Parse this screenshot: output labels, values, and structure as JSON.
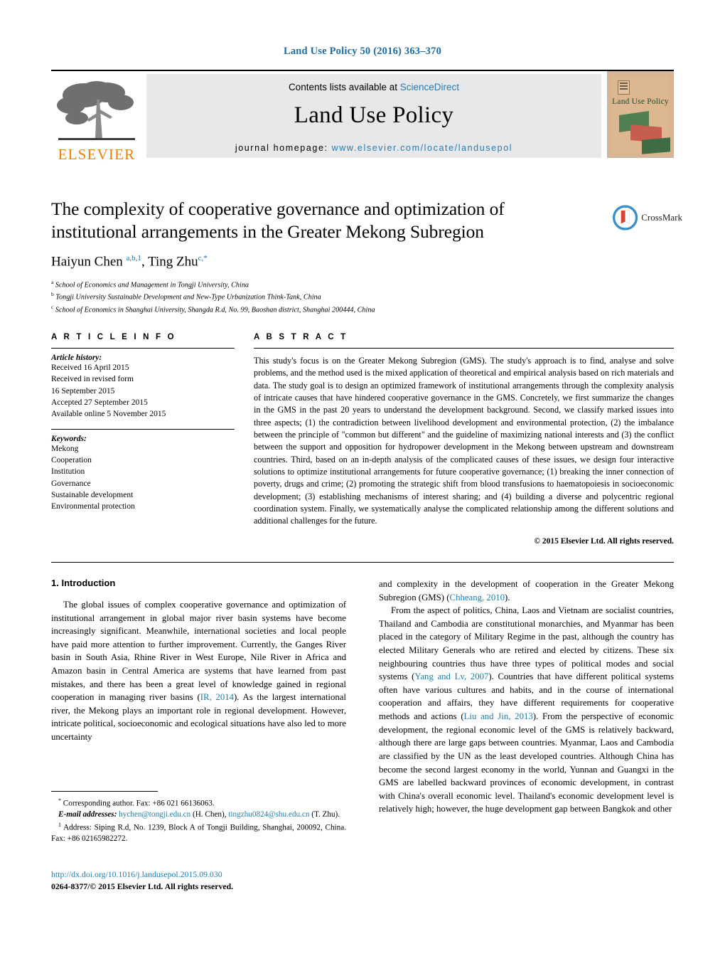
{
  "running_head": "Land Use Policy 50 (2016) 363–370",
  "masthead": {
    "contents_prefix": "Contents lists available at ",
    "sciencedirect": "ScienceDirect",
    "journal_name": "Land Use Policy",
    "homepage_label": "journal homepage:",
    "homepage_url": "www.elsevier.com/locate/landusepol",
    "publisher_name": "ELSEVIER",
    "cover_title": "Land Use Policy"
  },
  "article": {
    "title": "The complexity of cooperative governance and optimization of institutional arrangements in the Greater Mekong Subregion",
    "authors_html": "Haiyun Chen <sup>a,b,1</sup>, Ting Zhu<sup>c,*</sup>",
    "affiliations": [
      {
        "marker": "a",
        "text": "School of Economics and Management in Tongji University, China"
      },
      {
        "marker": "b",
        "text": "Tongji University Sustainable Development and New-Type Urbanization Think-Tank, China"
      },
      {
        "marker": "c",
        "text": "School of Economics in Shanghai University, Shangda R.d, No. 99, Baoshan district, Shanghai 200444, China"
      }
    ]
  },
  "crossmark": {
    "label": "CrossMark"
  },
  "article_info": {
    "heading": "A R T I C L E   I N F O",
    "history_heading": "Article history:",
    "history": [
      "Received 16 April 2015",
      "Received in revised form",
      "16 September 2015",
      "Accepted 27 September 2015",
      "Available online 5 November 2015"
    ],
    "keywords_heading": "Keywords:",
    "keywords": [
      "Mekong",
      "Cooperation",
      "Institution",
      "Governance",
      "Sustainable development",
      "Environmental protection"
    ]
  },
  "abstract": {
    "heading": "A B S T R A C T",
    "text": "This study's focus is on the Greater Mekong Subregion (GMS). The study's approach is to find, analyse and solve problems, and the method used is the mixed application of theoretical and empirical analysis based on rich materials and data. The study goal is to design an optimized framework of institutional arrangements through the complexity analysis of intricate causes that have hindered cooperative governance in the GMS. Concretely, we first summarize the changes in the GMS in the past 20 years to understand the development background. Second, we classify marked issues into three aspects; (1) the contradiction between livelihood development and environmental protection, (2) the imbalance between the principle of \"common but different\" and the guideline of maximizing national interests and (3) the conflict between the support and opposition for hydropower development in the Mekong between upstream and downstream countries. Third, based on an in-depth analysis of the complicated causes of these issues, we design four interactive solutions to optimize institutional arrangements for future cooperative governance; (1) breaking the inner connection of poverty, drugs and crime; (2) promoting the strategic shift from blood transfusions to haematopoiesis in socioeconomic development; (3) establishing mechanisms of interest sharing; and (4) building a diverse and polycentric regional coordination system. Finally, we systematically analyse the complicated relationship among the different solutions and additional challenges for the future.",
    "copyright": "© 2015 Elsevier Ltd. All rights reserved."
  },
  "body": {
    "section_number_title": "1.  Introduction",
    "left_paragraph_html": "The global issues of complex cooperative governance and optimization of institutional arrangement in global major river basin systems have become increasingly significant. Meanwhile, international societies and local people have paid more attention to further improvement. Currently, the Ganges River basin in South Asia, Rhine River in West Europe, Nile River in Africa and Amazon basin in Central America are systems that have learned from past mistakes, and there has been a great level of knowledge gained in regional cooperation in managing river basins (<span class=\"cite\">IR, 2014</span>). As the largest international river, the Mekong plays an important role in regional development. However, intricate political, socioeconomic and ecological situations have also led to more uncertainty",
    "right_paragraph_1_html": "and complexity in the development of cooperation in the Greater Mekong Subregion (GMS) (<span class=\"cite\">Chheang, 2010</span>).",
    "right_paragraph_2_html": "From the aspect of politics, China, Laos and Vietnam are socialist countries, Thailand and Cambodia are constitutional monarchies, and Myanmar has been placed in the category of Military Regime in the past, although the country has elected Military Generals who are retired and elected by citizens. These six neighbouring countries thus have three types of political modes and social systems (<span class=\"cite\">Yang and Lv, 2007</span>). Countries that have different political systems often have various cultures and habits, and in the course of international cooperation and affairs, they have different requirements for cooperative methods and actions (<span class=\"cite\">Liu and Jin, 2013</span>). From the perspective of economic development, the regional economic level of the GMS is relatively backward, although there are large gaps between countries. Myanmar, Laos and Cambodia are classified by the UN as the least developed countries. Although China has become the second largest economy in the world, Yunnan and Guangxi in the GMS are labelled backward provinces of economic development, in contrast with China's overall economic level. Thailand's economic development level is relatively high; however, the huge development gap between Bangkok and other"
  },
  "footnotes": {
    "corresponding_html": "<sup>*</sup>  Corresponding author. Fax: +86 021 66136063.",
    "email_html": "<em>E-mail addresses:</em> <span class=\"mail\">hychen@tongji.edu.cn</span> (H. Chen), <span class=\"mail\">tingzhu0824@shu.edu.cn</span> (T. Zhu).",
    "address_html": "<sup>1</sup>  Address: Siping R.d, No. 1239, Block A of Tongji Building, Shanghai, 200092, China. Fax: +86 02165982272."
  },
  "footer": {
    "doi": "http://dx.doi.org/10.1016/j.landusepol.2015.09.030",
    "issn": "0264-8377/© 2015 Elsevier Ltd. All rights reserved."
  }
}
